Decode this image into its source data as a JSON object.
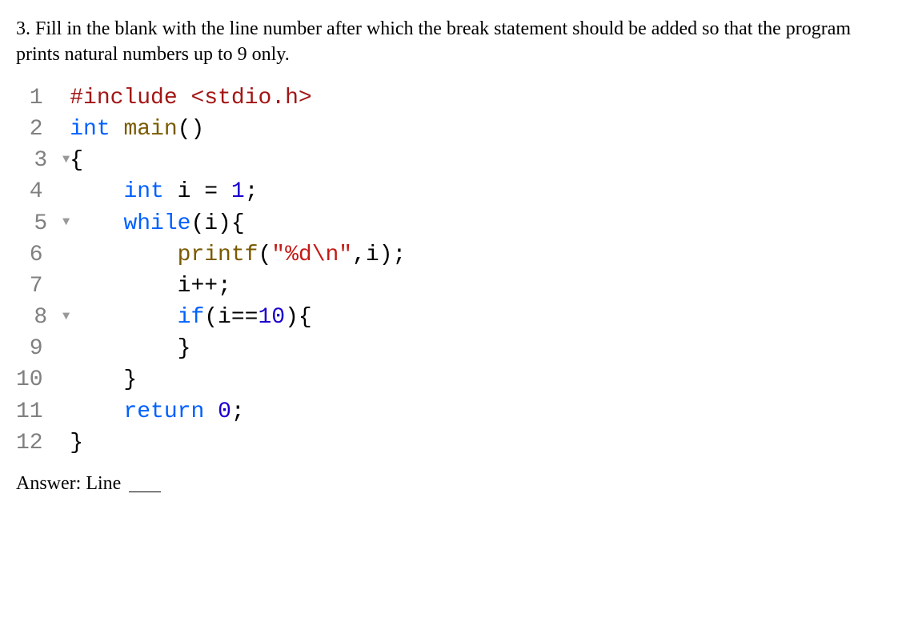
{
  "question": "3. Fill in the blank with the line number after which the break statement should be added so that the program prints natural numbers up to 9 only.",
  "code": {
    "lines": [
      {
        "n": "1",
        "fold": false,
        "tokens": [
          {
            "t": "#include ",
            "c": "tok-macro"
          },
          {
            "t": "<stdio.h>",
            "c": "tok-macro"
          }
        ]
      },
      {
        "n": "2",
        "fold": false,
        "tokens": [
          {
            "t": "int",
            "c": "tok-type"
          },
          {
            "t": " ",
            "c": "tok-plain"
          },
          {
            "t": "main",
            "c": "tok-func"
          },
          {
            "t": "()",
            "c": "tok-plain"
          }
        ]
      },
      {
        "n": "3",
        "fold": true,
        "tokens": [
          {
            "t": "{",
            "c": "tok-plain"
          }
        ]
      },
      {
        "n": "4",
        "fold": false,
        "tokens": [
          {
            "t": "    ",
            "c": "tok-plain"
          },
          {
            "t": "int",
            "c": "tok-type"
          },
          {
            "t": " i = ",
            "c": "tok-plain"
          },
          {
            "t": "1",
            "c": "tok-number"
          },
          {
            "t": ";",
            "c": "tok-plain"
          }
        ]
      },
      {
        "n": "5",
        "fold": true,
        "tokens": [
          {
            "t": "    ",
            "c": "tok-plain"
          },
          {
            "t": "while",
            "c": "tok-keyword"
          },
          {
            "t": "(i){",
            "c": "tok-plain"
          }
        ]
      },
      {
        "n": "6",
        "fold": false,
        "tokens": [
          {
            "t": "        ",
            "c": "tok-plain"
          },
          {
            "t": "printf",
            "c": "tok-func"
          },
          {
            "t": "(",
            "c": "tok-plain"
          },
          {
            "t": "\"%d\\n\"",
            "c": "tok-string"
          },
          {
            "t": ",i);",
            "c": "tok-plain"
          }
        ]
      },
      {
        "n": "7",
        "fold": false,
        "tokens": [
          {
            "t": "        i++;",
            "c": "tok-plain"
          }
        ]
      },
      {
        "n": "8",
        "fold": true,
        "tokens": [
          {
            "t": "        ",
            "c": "tok-plain"
          },
          {
            "t": "if",
            "c": "tok-keyword"
          },
          {
            "t": "(i==",
            "c": "tok-plain"
          },
          {
            "t": "10",
            "c": "tok-number"
          },
          {
            "t": "){",
            "c": "tok-plain"
          }
        ]
      },
      {
        "n": "9",
        "fold": false,
        "tokens": [
          {
            "t": "        }",
            "c": "tok-plain"
          }
        ]
      },
      {
        "n": "10",
        "fold": false,
        "tokens": [
          {
            "t": "    }",
            "c": "tok-plain"
          }
        ]
      },
      {
        "n": "11",
        "fold": false,
        "tokens": [
          {
            "t": "    ",
            "c": "tok-plain"
          },
          {
            "t": "return",
            "c": "tok-keyword"
          },
          {
            "t": " ",
            "c": "tok-plain"
          },
          {
            "t": "0",
            "c": "tok-number"
          },
          {
            "t": ";",
            "c": "tok-plain"
          }
        ]
      },
      {
        "n": "12",
        "fold": false,
        "tokens": [
          {
            "t": "}",
            "c": "tok-plain"
          }
        ]
      }
    ]
  },
  "answer_label": "Answer: Line"
}
